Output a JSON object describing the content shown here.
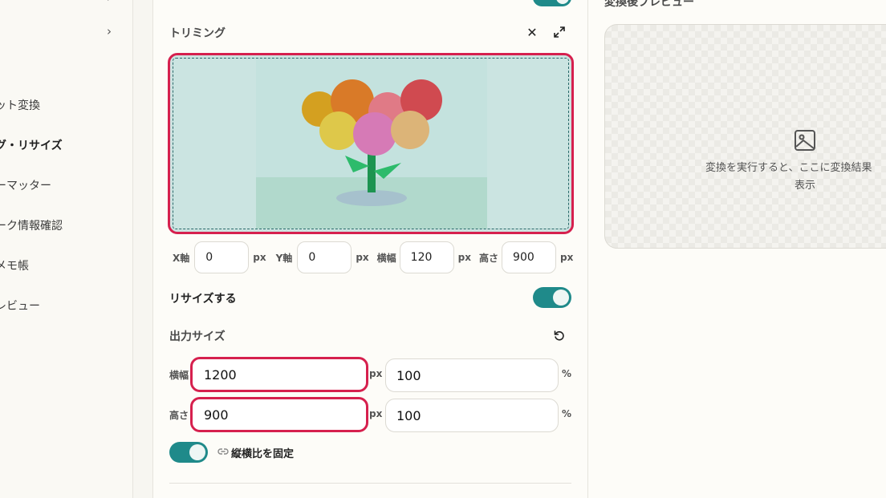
{
  "sidebar": {
    "items": [
      {
        "label": "ット変換",
        "active": false
      },
      {
        "label": "グ・リサイズ",
        "active": true
      },
      {
        "label": "ーマッター",
        "active": false
      },
      {
        "label": "ーク情報確認",
        "active": false
      },
      {
        "label": "メモ帳",
        "active": false
      },
      {
        "label": "レビュー",
        "active": false
      }
    ]
  },
  "trimming": {
    "title": "トリミング",
    "x_label": "X軸",
    "x_value": "0",
    "y_label": "Y軸",
    "y_value": "0",
    "w_label": "横幅",
    "w_value": "120",
    "h_label": "高さ",
    "h_value": "900",
    "unit": "px"
  },
  "resize": {
    "label": "リサイズする",
    "enabled": true,
    "output_title": "出力サイズ",
    "width_label": "横幅",
    "width_value": "1200",
    "width_pct": "100",
    "height_label": "高さ",
    "height_value": "900",
    "height_pct": "100",
    "px_unit": "px",
    "pct_unit": "%",
    "lock_label": "縦横比を固定"
  },
  "preview": {
    "title": "変換後プレビュー",
    "message_line1": "変換を実行すると、ここに変換結果",
    "message_line2": "表示"
  },
  "colors": {
    "accent": "#1f8a8a",
    "highlight": "#d6204e"
  }
}
